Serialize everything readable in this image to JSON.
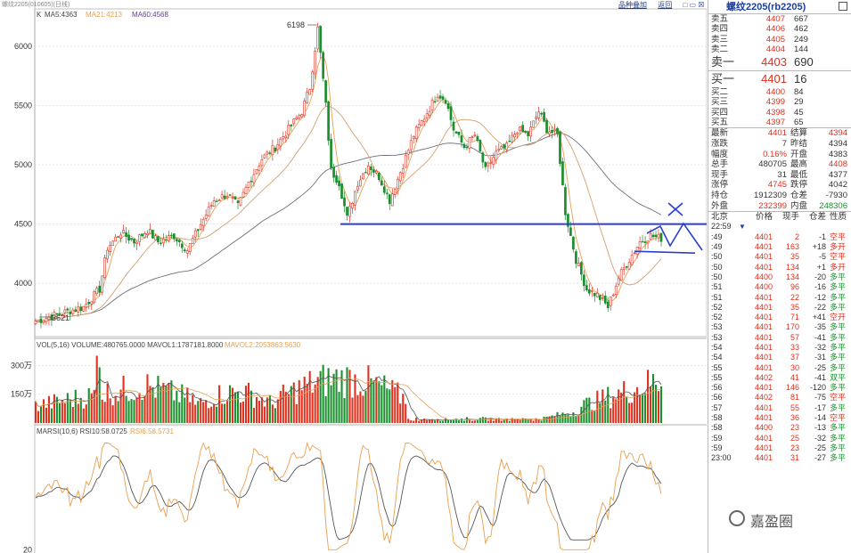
{
  "header": {
    "contract_line": "螺纹2205(010605)(日线)",
    "k_tag": "K",
    "ma5": "MA5:4363",
    "ma21": "MA21:4213",
    "ma60": "MA60:4568",
    "toolbar_add": "品种叠加",
    "toolbar_close": "返回",
    "toolbar_box": "□ ▭ ☒"
  },
  "colors": {
    "up": "#e0301e",
    "down": "#1b8f2e",
    "ma5": "#e8a050",
    "ma21": "#d4a070",
    "ma60": "#6e6e7e",
    "annot": "#2a3fd0",
    "grid": "#d8d8d8"
  },
  "chart_data": [
    {
      "type": "candlestick",
      "y_ticks": [
        "6000",
        "5500",
        "5000",
        "4500",
        "4000"
      ],
      "ylim": [
        3550,
        6300
      ],
      "annotations": {
        "high_label": "6198",
        "low_label": "3621",
        "horizontal_level": 4500,
        "support_level": 4270
      },
      "anchors": [
        [
          0,
          3680
        ],
        [
          10,
          3750
        ],
        [
          18,
          3800
        ],
        [
          24,
          3950
        ],
        [
          27,
          4300
        ],
        [
          32,
          4430
        ],
        [
          37,
          4350
        ],
        [
          42,
          4450
        ],
        [
          46,
          4350
        ],
        [
          52,
          4400
        ],
        [
          57,
          4280
        ],
        [
          62,
          4500
        ],
        [
          67,
          4700
        ],
        [
          72,
          4750
        ],
        [
          76,
          4650
        ],
        [
          80,
          4850
        ],
        [
          85,
          5050
        ],
        [
          90,
          5150
        ],
        [
          95,
          5300
        ],
        [
          100,
          5450
        ],
        [
          103,
          5650
        ],
        [
          106,
          6150
        ],
        [
          109,
          5500
        ],
        [
          111,
          4950
        ],
        [
          114,
          4850
        ],
        [
          117,
          4550
        ],
        [
          121,
          4850
        ],
        [
          125,
          5000
        ],
        [
          129,
          4900
        ],
        [
          133,
          4700
        ],
        [
          138,
          5000
        ],
        [
          142,
          5250
        ],
        [
          146,
          5400
        ],
        [
          151,
          5600
        ],
        [
          154,
          5550
        ],
        [
          157,
          5300
        ],
        [
          161,
          5150
        ],
        [
          165,
          5250
        ],
        [
          169,
          4950
        ],
        [
          173,
          5100
        ],
        [
          177,
          5150
        ],
        [
          181,
          5300
        ],
        [
          185,
          5250
        ],
        [
          189,
          5450
        ],
        [
          192,
          5300
        ],
        [
          196,
          5250
        ],
        [
          199,
          4600
        ],
        [
          203,
          4200
        ],
        [
          207,
          3950
        ],
        [
          211,
          3900
        ],
        [
          215,
          3800
        ],
        [
          219,
          4050
        ],
        [
          223,
          4200
        ],
        [
          227,
          4350
        ],
        [
          231,
          4400
        ],
        [
          235,
          4380
        ]
      ]
    },
    {
      "type": "bar",
      "title": "VOL(5,16) VOLUME:480765.0000 MAVOL1:1787181.8000 MAVOL2:2053863.5630",
      "y_ticks": [
        "300万",
        "150万"
      ],
      "ylim": [
        0,
        3800000
      ]
    },
    {
      "type": "line",
      "title": "MARSI(10,6) RSI10:58.0725 RSI6:58.5731",
      "y_ticks": [
        "20"
      ],
      "ylim": [
        18,
        88
      ]
    }
  ],
  "quote": {
    "title": "螺纹2205(rb2205)",
    "asks": [
      {
        "label": "卖五",
        "price": "4407",
        "vol": "667"
      },
      {
        "label": "卖四",
        "price": "4406",
        "vol": "462"
      },
      {
        "label": "卖三",
        "price": "4405",
        "vol": "249"
      },
      {
        "label": "卖二",
        "price": "4404",
        "vol": "144"
      }
    ],
    "best_ask": {
      "label": "卖一",
      "price": "4403",
      "vol": "690"
    },
    "best_bid": {
      "label": "买一",
      "price": "4401",
      "vol": "16"
    },
    "bids": [
      {
        "label": "买二",
        "price": "4400",
        "vol": "84"
      },
      {
        "label": "买三",
        "price": "4399",
        "vol": "29"
      },
      {
        "label": "买四",
        "price": "4398",
        "vol": "45"
      },
      {
        "label": "买五",
        "price": "4397",
        "vol": "65"
      }
    ],
    "stats": [
      {
        "l1": "最新",
        "v1": "4401",
        "c1": "red",
        "l2": "结算",
        "v2": "4394",
        "c2": "red"
      },
      {
        "l1": "涨跌",
        "v1": "7",
        "c1": "dark",
        "l2": "昨结",
        "v2": "4394",
        "c2": "dark"
      },
      {
        "l1": "幅度",
        "v1": "0.16%",
        "c1": "red",
        "l2": "开盘",
        "v2": "4383",
        "c2": "dark"
      },
      {
        "l1": "总手",
        "v1": "480705",
        "c1": "dark",
        "l2": "最高",
        "v2": "4408",
        "c2": "red"
      },
      {
        "l1": "现手",
        "v1": "31",
        "c1": "dark",
        "l2": "最低",
        "v2": "4377",
        "c2": "dark"
      },
      {
        "l1": "涨停",
        "v1": "4745",
        "c1": "red",
        "l2": "跌停",
        "v2": "4042",
        "c2": "dark"
      },
      {
        "l1": "持仓",
        "v1": "1912309",
        "c1": "dark",
        "l2": "仓差",
        "v2": "-7930",
        "c2": "dark"
      },
      {
        "l1": "外盘",
        "v1": "232399",
        "c1": "red",
        "l2": "内盘",
        "v2": "248306",
        "c2": "green"
      }
    ],
    "tick_header": {
      "time": "北京",
      "price": "价格",
      "hand": "现手",
      "oi": "仓差",
      "nature": "性质"
    },
    "tick_first_time": "22:59",
    "ticks": [
      {
        "time": ":49",
        "price": "4401",
        "hand": "2",
        "oi": "-1",
        "nature": "空平"
      },
      {
        "time": ":49",
        "price": "4401",
        "hand": "163",
        "oi": "+18",
        "nature": "多开"
      },
      {
        "time": ":50",
        "price": "4401",
        "hand": "35",
        "oi": "-5",
        "nature": "空平"
      },
      {
        "time": ":50",
        "price": "4401",
        "hand": "134",
        "oi": "+1",
        "nature": "多开"
      },
      {
        "time": ":50",
        "price": "4400",
        "hand": "134",
        "oi": "-20",
        "nature": "多平"
      },
      {
        "time": ":51",
        "price": "4400",
        "hand": "96",
        "oi": "-16",
        "nature": "多平"
      },
      {
        "time": ":51",
        "price": "4401",
        "hand": "22",
        "oi": "-12",
        "nature": "多平"
      },
      {
        "time": ":52",
        "price": "4401",
        "hand": "35",
        "oi": "-22",
        "nature": "多平"
      },
      {
        "time": ":52",
        "price": "4401",
        "hand": "71",
        "oi": "+41",
        "nature": "空开"
      },
      {
        "time": ":53",
        "price": "4401",
        "hand": "170",
        "oi": "-35",
        "nature": "多平"
      },
      {
        "time": ":53",
        "price": "4401",
        "hand": "57",
        "oi": "-41",
        "nature": "多平"
      },
      {
        "time": ":54",
        "price": "4401",
        "hand": "33",
        "oi": "-32",
        "nature": "多平"
      },
      {
        "time": ":54",
        "price": "4401",
        "hand": "37",
        "oi": "-31",
        "nature": "多平"
      },
      {
        "time": ":55",
        "price": "4401",
        "hand": "30",
        "oi": "-25",
        "nature": "多平"
      },
      {
        "time": ":55",
        "price": "4402",
        "hand": "41",
        "oi": "-41",
        "nature": "双平"
      },
      {
        "time": ":56",
        "price": "4401",
        "hand": "146",
        "oi": "-120",
        "nature": "多平"
      },
      {
        "time": ":56",
        "price": "4402",
        "hand": "81",
        "oi": "-75",
        "nature": "空平"
      },
      {
        "time": ":57",
        "price": "4401",
        "hand": "55",
        "oi": "-17",
        "nature": "多平"
      },
      {
        "time": ":58",
        "price": "4401",
        "hand": "36",
        "oi": "-14",
        "nature": "空平"
      },
      {
        "time": ":58",
        "price": "4400",
        "hand": "23",
        "oi": "-13",
        "nature": "多平"
      },
      {
        "time": ":59",
        "price": "4401",
        "hand": "25",
        "oi": "-32",
        "nature": "多平"
      },
      {
        "time": ":59",
        "price": "4401",
        "hand": "23",
        "oi": "-25",
        "nature": "多平"
      },
      {
        "time": "23:00",
        "price": "4401",
        "hand": "31",
        "oi": "-27",
        "nature": "多平"
      }
    ]
  },
  "watermark": {
    "text": "嘉盈圈"
  }
}
